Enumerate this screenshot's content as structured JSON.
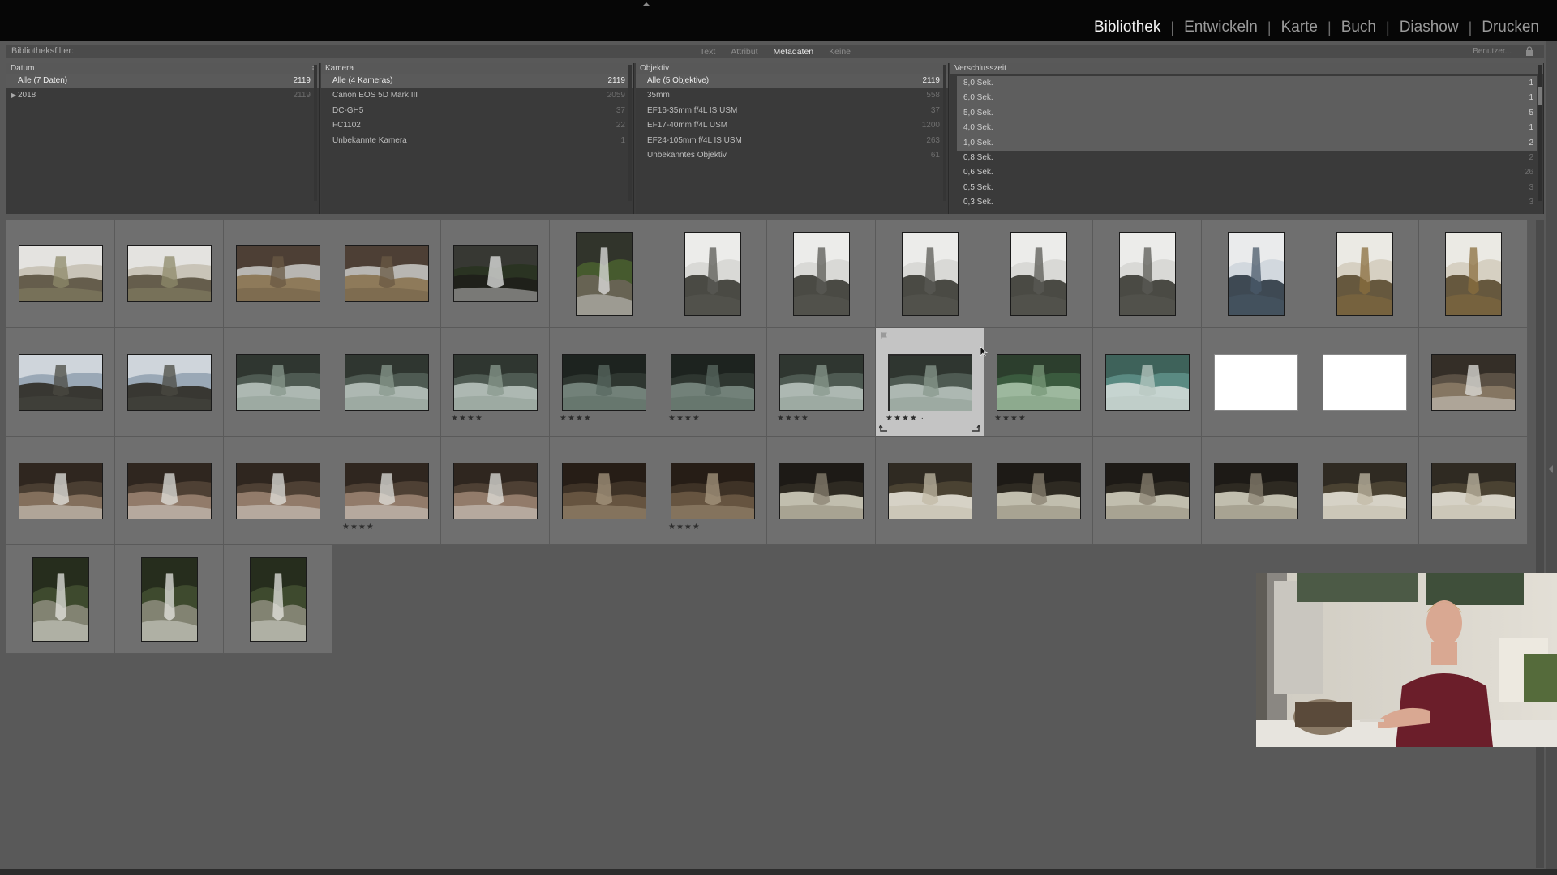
{
  "modules": [
    "Bibliothek",
    "Entwickeln",
    "Karte",
    "Buch",
    "Diashow",
    "Drucken"
  ],
  "active_module": "Bibliothek",
  "filter_bar": {
    "label": "Bibliotheksfilter:",
    "tabs": [
      "Text",
      "Attribut",
      "Metadaten",
      "Keine"
    ],
    "active_tab": "Metadaten",
    "preset": "Benutzer..."
  },
  "metadata": {
    "datum": {
      "header": "Datum",
      "rows": [
        {
          "label": "Alle (7 Daten)",
          "count": "2119",
          "selected": true
        },
        {
          "label": "2018",
          "count": "2119",
          "dim": true,
          "expandable": true
        }
      ]
    },
    "kamera": {
      "header": "Kamera",
      "rows": [
        {
          "label": "Alle (4 Kameras)",
          "count": "2119",
          "selected": true
        },
        {
          "label": "Canon EOS 5D Mark III",
          "count": "2059",
          "dim": true
        },
        {
          "label": "DC-GH5",
          "count": "37",
          "dim": true
        },
        {
          "label": "FC1102",
          "count": "22",
          "dim": true
        },
        {
          "label": "Unbekannte Kamera",
          "count": "1",
          "dim": true
        }
      ]
    },
    "objektiv": {
      "header": "Objektiv",
      "rows": [
        {
          "label": "Alle (5 Objektive)",
          "count": "2119",
          "selected": true
        },
        {
          "label": "35mm",
          "count": "558",
          "dim": true
        },
        {
          "label": "EF16-35mm f/4L IS USM",
          "count": "37",
          "dim": true
        },
        {
          "label": "EF17-40mm f/4L USM",
          "count": "1200",
          "dim": true
        },
        {
          "label": "EF24-105mm f/4L IS USM",
          "count": "263",
          "dim": true
        },
        {
          "label": "Unbekanntes Objektiv",
          "count": "61",
          "dim": true
        }
      ]
    },
    "verschlusszeit": {
      "header": "Verschlusszeit",
      "rows": [
        {
          "label": "8,0 Sek.",
          "count": "1",
          "selected": true
        },
        {
          "label": "6,0 Sek.",
          "count": "1",
          "selected": true
        },
        {
          "label": "5,0 Sek.",
          "count": "5",
          "selected": true
        },
        {
          "label": "4,0 Sek.",
          "count": "1",
          "selected": true
        },
        {
          "label": "1,0 Sek.",
          "count": "2",
          "selected": true
        },
        {
          "label": "0,8 Sek.",
          "count": "2",
          "dim": true
        },
        {
          "label": "0,6 Sek.",
          "count": "26",
          "dim": true
        },
        {
          "label": "0,5 Sek.",
          "count": "3",
          "dim": true
        },
        {
          "label": "0,3 Sek.",
          "count": "3",
          "dim": true
        }
      ]
    }
  },
  "grid": {
    "stars_text": "★★★★",
    "selected_stars_text": "★★★★ ·",
    "thumbnails": [
      {
        "orient": "land",
        "tone": "falls-bright"
      },
      {
        "orient": "land",
        "tone": "falls-bright"
      },
      {
        "orient": "land",
        "tone": "rock"
      },
      {
        "orient": "land",
        "tone": "rock"
      },
      {
        "orient": "land",
        "tone": "stream-dark"
      },
      {
        "orient": "port",
        "tone": "stream-forest"
      },
      {
        "orient": "port",
        "tone": "falls-grey"
      },
      {
        "orient": "port",
        "tone": "falls-grey"
      },
      {
        "orient": "port",
        "tone": "falls-grey"
      },
      {
        "orient": "port",
        "tone": "falls-grey"
      },
      {
        "orient": "port",
        "tone": "falls-grey"
      },
      {
        "orient": "port",
        "tone": "falls-blue"
      },
      {
        "orient": "port",
        "tone": "falls-autumn"
      },
      {
        "orient": "port",
        "tone": "falls-autumn"
      },
      {
        "orient": "land",
        "tone": "glen"
      },
      {
        "orient": "land",
        "tone": "glen"
      },
      {
        "orient": "land",
        "tone": "pool"
      },
      {
        "orient": "land",
        "tone": "pool"
      },
      {
        "orient": "land",
        "tone": "pool",
        "stars": true
      },
      {
        "orient": "land",
        "tone": "pool-dark",
        "stars": true
      },
      {
        "orient": "land",
        "tone": "pool-dark",
        "stars": true
      },
      {
        "orient": "land",
        "tone": "pool",
        "stars": true
      },
      {
        "orient": "land",
        "tone": "pool",
        "stars": true,
        "selected": true
      },
      {
        "orient": "land",
        "tone": "pool-green",
        "stars": true
      },
      {
        "orient": "land",
        "tone": "pool-teal"
      },
      {
        "orient": "land",
        "tone": "blank"
      },
      {
        "orient": "land",
        "tone": "blank"
      },
      {
        "orient": "land",
        "tone": "falls-rocks"
      },
      {
        "orient": "land",
        "tone": "ledge"
      },
      {
        "orient": "land",
        "tone": "ledge-person"
      },
      {
        "orient": "land",
        "tone": "ledge-person"
      },
      {
        "orient": "land",
        "tone": "ledge-person",
        "stars": true
      },
      {
        "orient": "land",
        "tone": "ledge-person"
      },
      {
        "orient": "land",
        "tone": "creek-brown"
      },
      {
        "orient": "land",
        "tone": "creek-brown",
        "stars": true
      },
      {
        "orient": "land",
        "tone": "wood-dark"
      },
      {
        "orient": "land",
        "tone": "wood"
      },
      {
        "orient": "land",
        "tone": "wood-dark"
      },
      {
        "orient": "land",
        "tone": "wood-dark"
      },
      {
        "orient": "land",
        "tone": "wood-dark"
      },
      {
        "orient": "land",
        "tone": "wood"
      },
      {
        "orient": "land",
        "tone": "wood"
      },
      {
        "orient": "port",
        "tone": "forest-falls"
      },
      {
        "orient": "port",
        "tone": "forest-falls"
      },
      {
        "orient": "port",
        "tone": "forest-falls"
      }
    ]
  },
  "colors": {
    "accent": "#f2f2f2",
    "panel": "#3a3a3a",
    "grid_bg": "#595959",
    "cell": "#6f6f6f",
    "cell_selected": "#c4c4c4"
  }
}
